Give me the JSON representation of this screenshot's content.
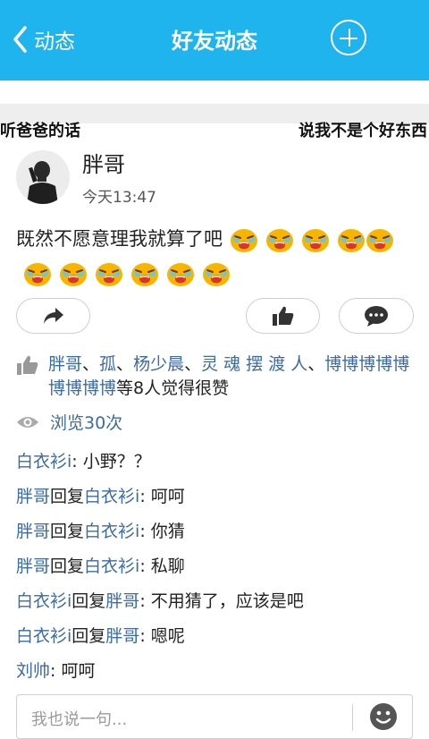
{
  "header": {
    "back_label": "动态",
    "title": "好友动态"
  },
  "banner": {
    "left": "听爸爸的话",
    "right": "说我不是个好东西"
  },
  "post": {
    "username": "胖哥",
    "time": "今天13:47",
    "text": "既然不愿意理我就算了吧",
    "emoji_name": "crying-face-emoji"
  },
  "likes": {
    "names": [
      "胖哥",
      "孤",
      "杨少晨",
      "灵 魂 摆 渡 人",
      "博博博博博博博博博"
    ],
    "separator": "、",
    "suffix": "等8人觉得很赞"
  },
  "views": {
    "label": "浏览30次"
  },
  "comments": [
    {
      "author": "白衣衫i",
      "text": ": 小野？？"
    },
    {
      "author": "胖哥",
      "reply_word": "回复",
      "target": "白衣衫i",
      "text": ": 呵呵"
    },
    {
      "author": "胖哥",
      "reply_word": "回复",
      "target": "白衣衫i",
      "text": ": 你猜"
    },
    {
      "author": "胖哥",
      "reply_word": "回复",
      "target": "白衣衫i",
      "text": ": 私聊"
    },
    {
      "author": "白衣衫i",
      "reply_word": "回复",
      "target": "胖哥",
      "text": ": 不用猜了，应该是吧"
    },
    {
      "author": "白衣衫i",
      "reply_word": "回复",
      "target": "胖哥",
      "text": ": 嗯呢"
    },
    {
      "author": "刘帅",
      "text": ": 呵呵"
    }
  ],
  "input": {
    "placeholder": "我也说一句..."
  },
  "colors": {
    "header": "#1fb4ee",
    "link": "#3b6aa5",
    "emoji": "#f7b500"
  }
}
